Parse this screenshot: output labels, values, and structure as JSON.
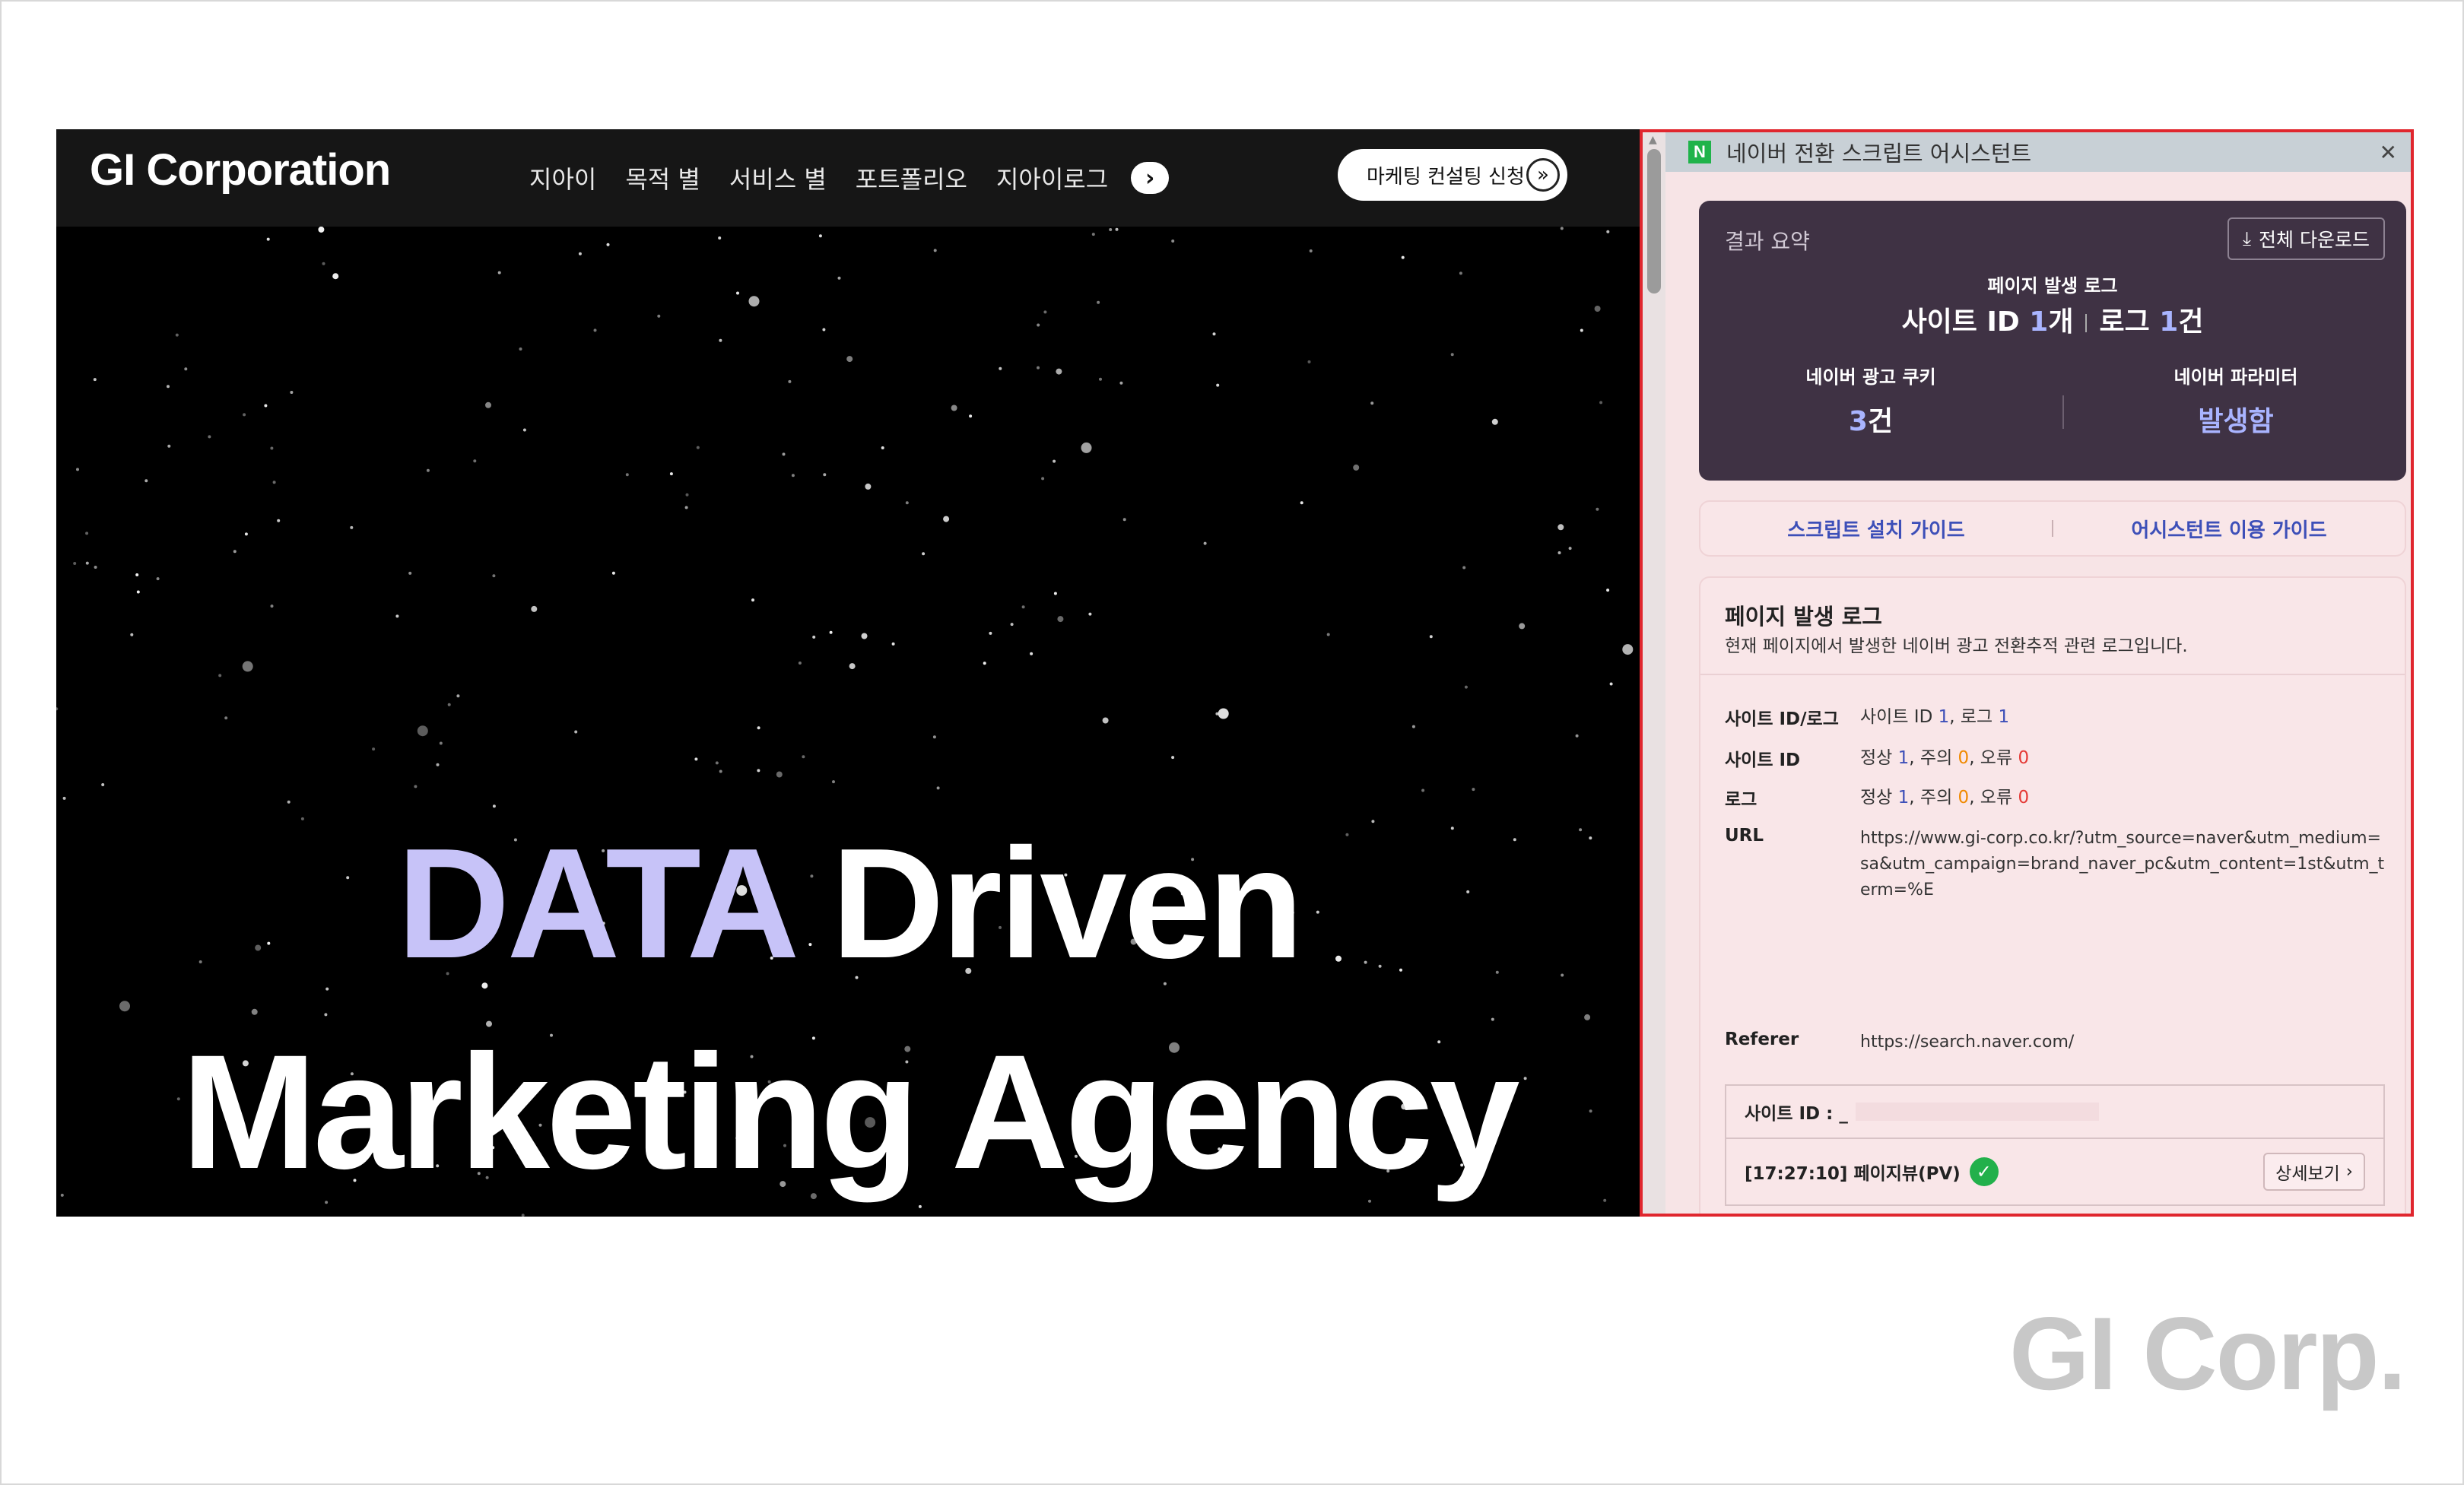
{
  "website": {
    "logo": "GI Corporation",
    "nav": [
      "지아이",
      "목적 별",
      "서비스 별",
      "포트폴리오",
      "지아이로그"
    ],
    "nav_more_icon": "chevron-right-icon",
    "cta_label": "마케팅 컨설팅 신청",
    "hero": {
      "accent": "DATA",
      "line1_rest": " Driven",
      "line2": "Marketing Agency",
      "accent_color": "#c7c3f8"
    }
  },
  "extension": {
    "title": "네이버 전환 스크립트 어시스턴트",
    "badge": "N",
    "summary": {
      "title": "결과 요약",
      "download_label": "전체 다운로드",
      "subtitle": "페이지 발생 로그",
      "site_id_label": "사이트 ID ",
      "site_id_count": "1",
      "site_id_unit": "개",
      "log_label": "로그 ",
      "log_count": "1",
      "log_unit": "건",
      "cookie_label": "네이버 광고 쿠키",
      "cookie_count": "3",
      "cookie_unit": "건",
      "param_label": "네이버 파라미터",
      "param_value": "발생함"
    },
    "guides": {
      "install": "스크립트 설치 가이드",
      "usage": "어시스턴트 이용 가이드"
    },
    "page_log": {
      "heading": "페이지 발생 로그",
      "description": "현재 페이지에서 발생한 네이버 광고 전환추적 관련 로그입니다.",
      "rows": {
        "siteid_log": {
          "key": "사이트 ID/로그",
          "a": "사이트 ID ",
          "a_num": "1",
          "b": ", 로그 ",
          "b_num": "1"
        },
        "siteid": {
          "key": "사이트 ID",
          "normal": "정상 ",
          "n1": "1",
          "warn": ", 주의 ",
          "n2": "0",
          "err": ", 오류 ",
          "n3": "0"
        },
        "log": {
          "key": "로그",
          "normal": "정상 ",
          "n1": "1",
          "warn": ", 주의 ",
          "n2": "0",
          "err": ", 오류 ",
          "n3": "0"
        },
        "url": {
          "key": "URL",
          "value": "https://www.gi-corp.co.kr/?utm_source=naver&utm_medium=sa&utm_campaign=brand_naver_pc&utm_content=1st&utm_term=%E"
        },
        "referer": {
          "key": "Referer",
          "value": "https://search.naver.com/"
        }
      },
      "site_box": {
        "label": "사이트 ID :  _",
        "event": "[17:27:10] 페이지뷰(PV)",
        "detail_label": "상세보기"
      }
    }
  },
  "watermark": "GI Corp.",
  "colors": {
    "panel_border": "#e0262e",
    "panel_bg": "#f7e4e6",
    "summary_bg": "#3f3244",
    "accent_blue": "#3d4fb8",
    "ok_green": "#22b04b"
  }
}
